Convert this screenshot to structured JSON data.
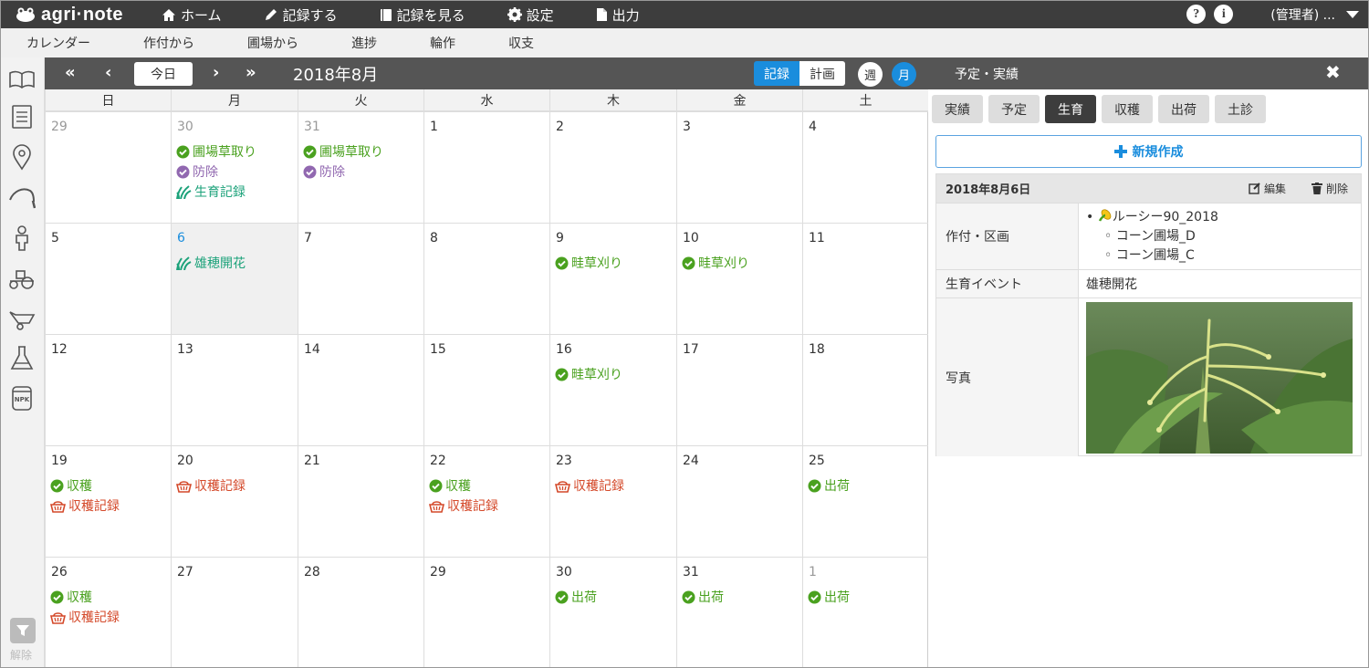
{
  "app": {
    "brand": "agri·note"
  },
  "topnav": [
    {
      "label": "ホーム",
      "icon": "home-icon"
    },
    {
      "label": "記録する",
      "icon": "pencil-icon"
    },
    {
      "label": "記録を見る",
      "icon": "book-icon"
    },
    {
      "label": "設定",
      "icon": "gear-icon"
    },
    {
      "label": "出力",
      "icon": "document-icon"
    }
  ],
  "help_icon": "?",
  "info_icon": "i",
  "user": "(管理者) ...",
  "subnav": [
    "カレンダー",
    "作付から",
    "圃場から",
    "進捗",
    "輪作",
    "収支"
  ],
  "sidebar": {
    "icons": [
      "book-open-icon",
      "notebook-icon",
      "map-pin-icon",
      "sickle-icon",
      "worker-icon",
      "tractor-icon",
      "wheelbarrow-icon",
      "flask-icon",
      "fertilizer-bag-icon"
    ],
    "filter_label": "解除"
  },
  "toolbar": {
    "prev_year": "«",
    "prev": "‹",
    "today": "今日",
    "next": "›",
    "next_year": "»",
    "month_title": "2018年8月",
    "mode_record": "記録",
    "mode_plan": "計画",
    "view_week": "週",
    "view_month": "月",
    "panel_title": "予定・実績",
    "close": "✖"
  },
  "weekdays": [
    "日",
    "月",
    "火",
    "水",
    "木",
    "金",
    "土"
  ],
  "colors": {
    "green": "#4aa11f",
    "purple": "#9168b0",
    "teal": "#1ca27a",
    "red": "#d4492a",
    "blue": "#1a8ddd"
  },
  "weeks": [
    [
      {
        "day": "29",
        "other": true,
        "events": []
      },
      {
        "day": "30",
        "other": true,
        "events": [
          {
            "type": "check",
            "color": "green",
            "label": "圃場草取り"
          },
          {
            "type": "check",
            "color": "purple",
            "label": "防除"
          },
          {
            "type": "growth",
            "color": "teal",
            "label": "生育記録"
          }
        ]
      },
      {
        "day": "31",
        "other": true,
        "events": [
          {
            "type": "check",
            "color": "green",
            "label": "圃場草取り"
          },
          {
            "type": "check",
            "color": "purple",
            "label": "防除"
          }
        ]
      },
      {
        "day": "1",
        "events": []
      },
      {
        "day": "2",
        "events": []
      },
      {
        "day": "3",
        "events": []
      },
      {
        "day": "4",
        "events": []
      }
    ],
    [
      {
        "day": "5",
        "events": []
      },
      {
        "day": "6",
        "today": true,
        "events": [
          {
            "type": "growth",
            "color": "teal",
            "label": "雄穂開花"
          }
        ]
      },
      {
        "day": "7",
        "events": []
      },
      {
        "day": "8",
        "events": []
      },
      {
        "day": "9",
        "events": [
          {
            "type": "check",
            "color": "green",
            "label": "畦草刈り"
          }
        ]
      },
      {
        "day": "10",
        "events": [
          {
            "type": "check",
            "color": "green",
            "label": "畦草刈り"
          }
        ]
      },
      {
        "day": "11",
        "events": []
      }
    ],
    [
      {
        "day": "12",
        "events": []
      },
      {
        "day": "13",
        "events": []
      },
      {
        "day": "14",
        "events": []
      },
      {
        "day": "15",
        "events": []
      },
      {
        "day": "16",
        "events": [
          {
            "type": "check",
            "color": "green",
            "label": "畦草刈り"
          }
        ]
      },
      {
        "day": "17",
        "events": []
      },
      {
        "day": "18",
        "events": []
      }
    ],
    [
      {
        "day": "19",
        "events": [
          {
            "type": "check",
            "color": "green",
            "label": "収穫"
          },
          {
            "type": "basket",
            "color": "red",
            "label": "収穫記録"
          }
        ]
      },
      {
        "day": "20",
        "events": [
          {
            "type": "basket",
            "color": "red",
            "label": "収穫記録"
          }
        ]
      },
      {
        "day": "21",
        "events": []
      },
      {
        "day": "22",
        "events": [
          {
            "type": "check",
            "color": "green",
            "label": "収穫"
          },
          {
            "type": "basket",
            "color": "red",
            "label": "収穫記録"
          }
        ]
      },
      {
        "day": "23",
        "events": [
          {
            "type": "basket",
            "color": "red",
            "label": "収穫記録"
          }
        ]
      },
      {
        "day": "24",
        "events": []
      },
      {
        "day": "25",
        "events": [
          {
            "type": "check",
            "color": "green",
            "label": "出荷"
          }
        ]
      }
    ],
    [
      {
        "day": "26",
        "events": [
          {
            "type": "check",
            "color": "green",
            "label": "収穫"
          },
          {
            "type": "basket",
            "color": "red",
            "label": "収穫記録"
          }
        ]
      },
      {
        "day": "27",
        "events": []
      },
      {
        "day": "28",
        "events": []
      },
      {
        "day": "29",
        "events": []
      },
      {
        "day": "30",
        "events": [
          {
            "type": "check",
            "color": "green",
            "label": "出荷"
          }
        ]
      },
      {
        "day": "31",
        "events": [
          {
            "type": "check",
            "color": "green",
            "label": "出荷"
          }
        ]
      },
      {
        "day": "1",
        "other": true,
        "events": [
          {
            "type": "check",
            "color": "green",
            "label": "出荷"
          }
        ]
      }
    ]
  ],
  "panel": {
    "tabs": [
      {
        "label": "実績"
      },
      {
        "label": "予定"
      },
      {
        "label": "生育",
        "active": true
      },
      {
        "label": "収穫"
      },
      {
        "label": "出荷"
      },
      {
        "label": "土診"
      }
    ],
    "new_button": "新規作成",
    "record": {
      "date": "2018年8月6日",
      "edit": "編集",
      "delete": "削除",
      "crop_label": "作付・区画",
      "crop_name": "ルーシー90_2018",
      "crop_icon": "corn-icon",
      "fields": [
        "コーン圃場_D",
        "コーン圃場_C"
      ],
      "event_label": "生育イベント",
      "event_value": "雄穂開花",
      "photo_label": "写真",
      "photo_subject": "corn-tassel-photo"
    }
  }
}
